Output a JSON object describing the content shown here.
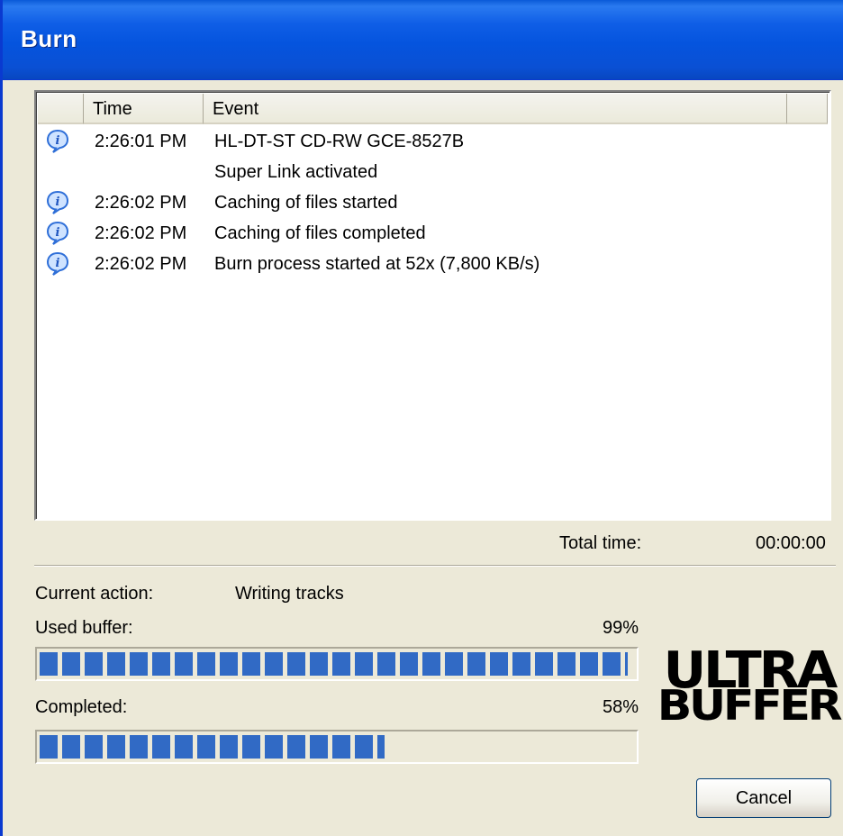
{
  "window": {
    "title": "Burn"
  },
  "log": {
    "columns": [
      "",
      "Time",
      "Event"
    ],
    "rows": [
      {
        "icon": "info-icon",
        "time": "2:26:01 PM",
        "event": "HL-DT-ST CD-RW GCE-8527B"
      },
      {
        "icon": "",
        "time": "",
        "event": "Super Link activated"
      },
      {
        "icon": "info-icon",
        "time": "2:26:02 PM",
        "event": "Caching of files started"
      },
      {
        "icon": "info-icon",
        "time": "2:26:02 PM",
        "event": "Caching of files completed"
      },
      {
        "icon": "info-icon",
        "time": "2:26:02 PM",
        "event": "Burn process started at 52x (7,800 KB/s)"
      }
    ]
  },
  "totals": {
    "label": "Total time:",
    "value": "00:00:00"
  },
  "current_action": {
    "label": "Current action:",
    "value": "Writing tracks"
  },
  "used_buffer": {
    "label": "Used buffer:",
    "value": "99%",
    "fraction": 0.99
  },
  "completed": {
    "label": "Completed:",
    "value": "58%",
    "fraction": 0.58
  },
  "logo": {
    "line1": "ULTRA",
    "line2": "BUFFER"
  },
  "buttons": {
    "cancel": "Cancel"
  },
  "colors": {
    "title_bar": "#0a5ad8",
    "progress": "#316ac5",
    "info_icon": "#2f6fd8"
  }
}
